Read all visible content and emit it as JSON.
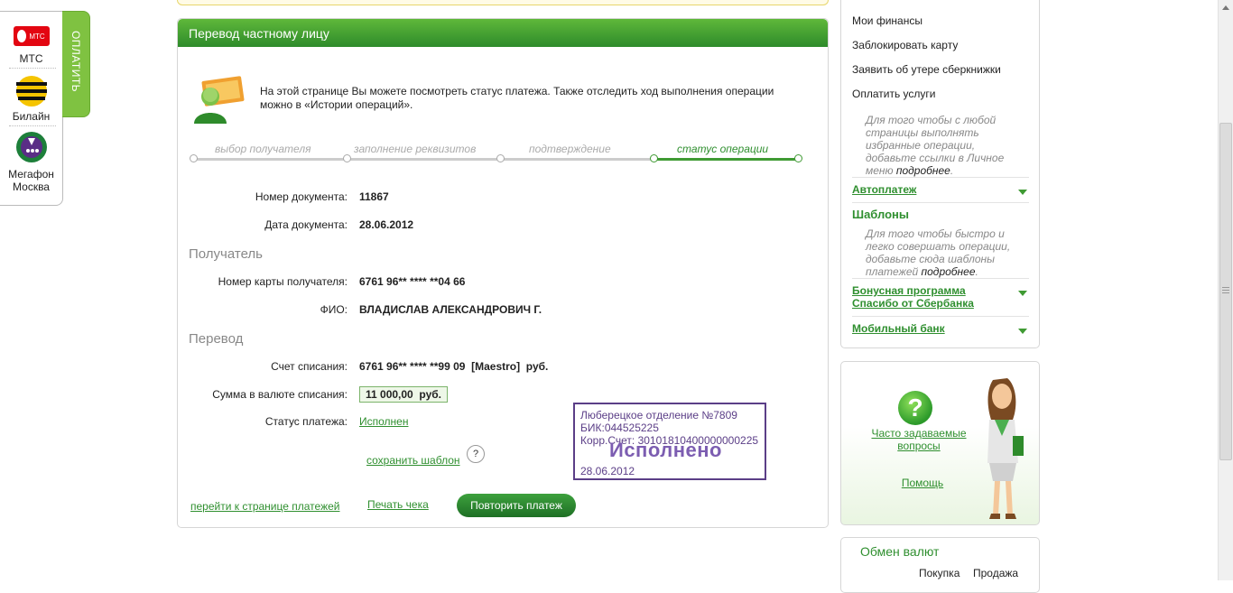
{
  "operators": {
    "pay_tab": "ОПЛАТИТЬ",
    "items": [
      {
        "label": "МТС",
        "icon": "mts-logo-icon"
      },
      {
        "label": "Билайн",
        "icon": "beeline-logo-icon"
      },
      {
        "label": "Мегафон Москва",
        "icon": "megafon-logo-icon"
      }
    ],
    "mts_badge": "МТС"
  },
  "main": {
    "title": "Перевод частному лицу",
    "intro": "На этой странице Вы можете посмотреть статус платежа. Также отследить ход выполнения операции можно в «Истории операций».",
    "steps": [
      "выбор получателя",
      "заполнение реквизитов",
      "подтверждение",
      "статус операции"
    ],
    "active_step": 4,
    "doc_number_label": "Номер документа:",
    "doc_number": "11867",
    "doc_date_label": "Дата документа:",
    "doc_date": "28.06.2012",
    "recipient_section": "Получатель",
    "card_label": "Номер карты получателя:",
    "card": "6761 96** **** **04 66",
    "fio_label": "ФИО:",
    "fio": "ВЛАДИСЛАВ АЛЕКСАНДРОВИЧ Г.",
    "transfer_section": "Перевод",
    "account_label": "Счет списания:",
    "account": "6761 96** **** **99 09  [Maestro]  руб.",
    "amount_label": "Сумма в валюте списания:",
    "amount": "11 000,00  руб.",
    "status_label": "Статус платежа:",
    "status": "Исполнен",
    "save_template": "сохранить шаблон",
    "help_q": "?",
    "stamp": {
      "line1": "Люберецкое отделение №7809",
      "line2": "БИК:044525225",
      "line3": "Корр.Счет: 30101810400000000225",
      "big": "Исполнено",
      "date": "28.06.2012"
    },
    "go_payments": "перейти к странице платежей",
    "print_check": "Печать чека",
    "repeat": "Повторить платеж"
  },
  "right": {
    "links": [
      "Мои финансы",
      "Заблокировать карту",
      "Заявить об утере сберкнижки",
      "Оплатить услуги"
    ],
    "favorites_note": "Для того чтобы с любой страницы выполнять избранные операции, добавьте ссылки в Личное меню",
    "favorites_more": "подробнее",
    "autopay": "Автоплатеж",
    "templates_title": "Шаблоны",
    "templates_note": "Для того чтобы быстро и легко совершать операции, добавьте сюда шаблоны платежей",
    "templates_more": "подробнее",
    "bonus": "Бонусная программа Спасибо от Сбербанка",
    "mobile_bank": "Мобильный банк",
    "faq": "Часто задаваемые вопросы",
    "help": "Помощь",
    "currency_title": "Обмен валют",
    "buy": "Покупка",
    "sell": "Продажа"
  },
  "colors": {
    "green": "#2f8f2f",
    "header_green": "#3f9a33",
    "stamp": "#5b3e87"
  }
}
